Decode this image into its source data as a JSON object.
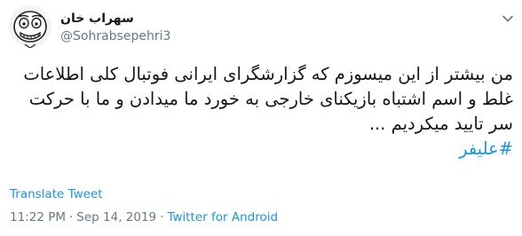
{
  "user": {
    "display_name": "سهراب خان",
    "handle": "@Sohrabsepehri3",
    "avatar_icon": "cartoon-face-avatar-icon"
  },
  "menu": {
    "icon": "chevron-down-icon"
  },
  "tweet": {
    "text": "من بیشتر از این میسوزم که گزارشگرای ایرانی فوتبال کلی اطلاعات غلط و اسم اشتباه بازیکنای خارجی به خورد ما میدادن و ما با حرکت سر تایید میکردیم ...",
    "hashtag": "#علیفر"
  },
  "actions": {
    "translate_label": "Translate Tweet"
  },
  "meta": {
    "time": "11:22 PM",
    "date": "Sep 14, 2019",
    "separator": "·",
    "source": "Twitter for Android"
  },
  "colors": {
    "link": "#1b95e0",
    "secondary_text": "#657786",
    "primary_text": "#14171a"
  }
}
